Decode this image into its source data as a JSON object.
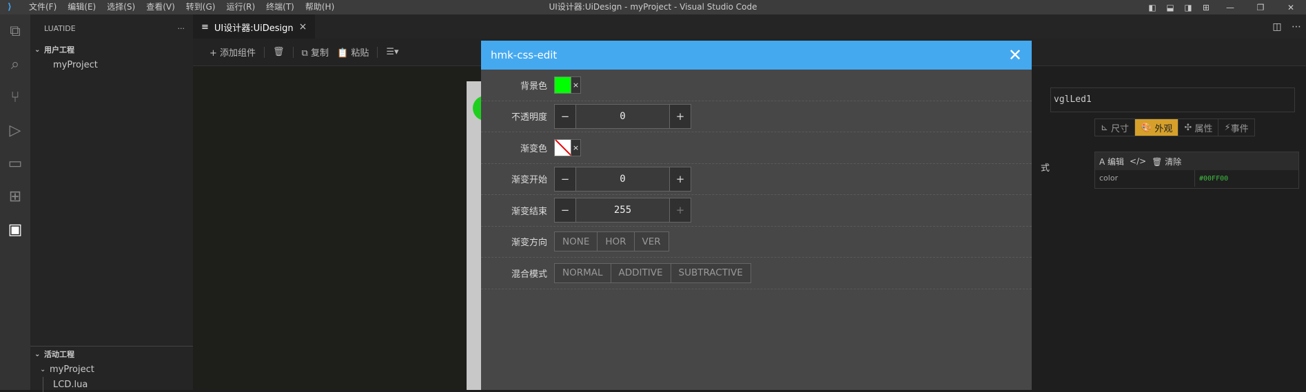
{
  "window": {
    "title": "UI设计器:UiDesign - myProject - Visual Studio Code",
    "menu": [
      "文件(F)",
      "编辑(E)",
      "选择(S)",
      "查看(V)",
      "转到(G)",
      "运行(R)",
      "终端(T)",
      "帮助(H)"
    ]
  },
  "sidebar": {
    "title": "LUATIDE",
    "more": "···",
    "user_section": "用户工程",
    "user_items": [
      "myProject"
    ],
    "active_section": "活动工程",
    "active_project": "myProject",
    "active_file": "LCD.lua"
  },
  "editor": {
    "tab_label": "UI设计器:UiDesign",
    "tab_close": "×"
  },
  "toolbar": {
    "add": "+ 添加组件",
    "copy": "复制",
    "paste": "粘贴"
  },
  "right_panel": {
    "name_value": "vglLed1",
    "tabs": [
      "尺寸",
      "外观",
      "属性",
      "事件"
    ],
    "active_tab": "外观",
    "style_label": "式",
    "edit": "编辑",
    "clear": "清除",
    "prop_key": "color",
    "prop_value": "#00FF00"
  },
  "dialog": {
    "title": "hmk-css-edit",
    "close": "✕",
    "rows": {
      "bg_color": {
        "label": "背景色",
        "color": "#00ff00",
        "clear": "×"
      },
      "opacity": {
        "label": "不透明度",
        "value": "0",
        "minus": "−",
        "plus": "+"
      },
      "grad_color": {
        "label": "渐变色",
        "clear": "×"
      },
      "grad_start": {
        "label": "渐变开始",
        "value": "0",
        "minus": "−",
        "plus": "+"
      },
      "grad_end": {
        "label": "渐变结束",
        "value": "255",
        "minus": "−",
        "plus": "+"
      },
      "grad_dir": {
        "label": "渐变方向",
        "options": [
          "NONE",
          "HOR",
          "VER"
        ]
      },
      "blend": {
        "label": "混合模式",
        "options": [
          "NORMAL",
          "ADDITIVE",
          "SUBTRACTIVE"
        ]
      }
    }
  }
}
